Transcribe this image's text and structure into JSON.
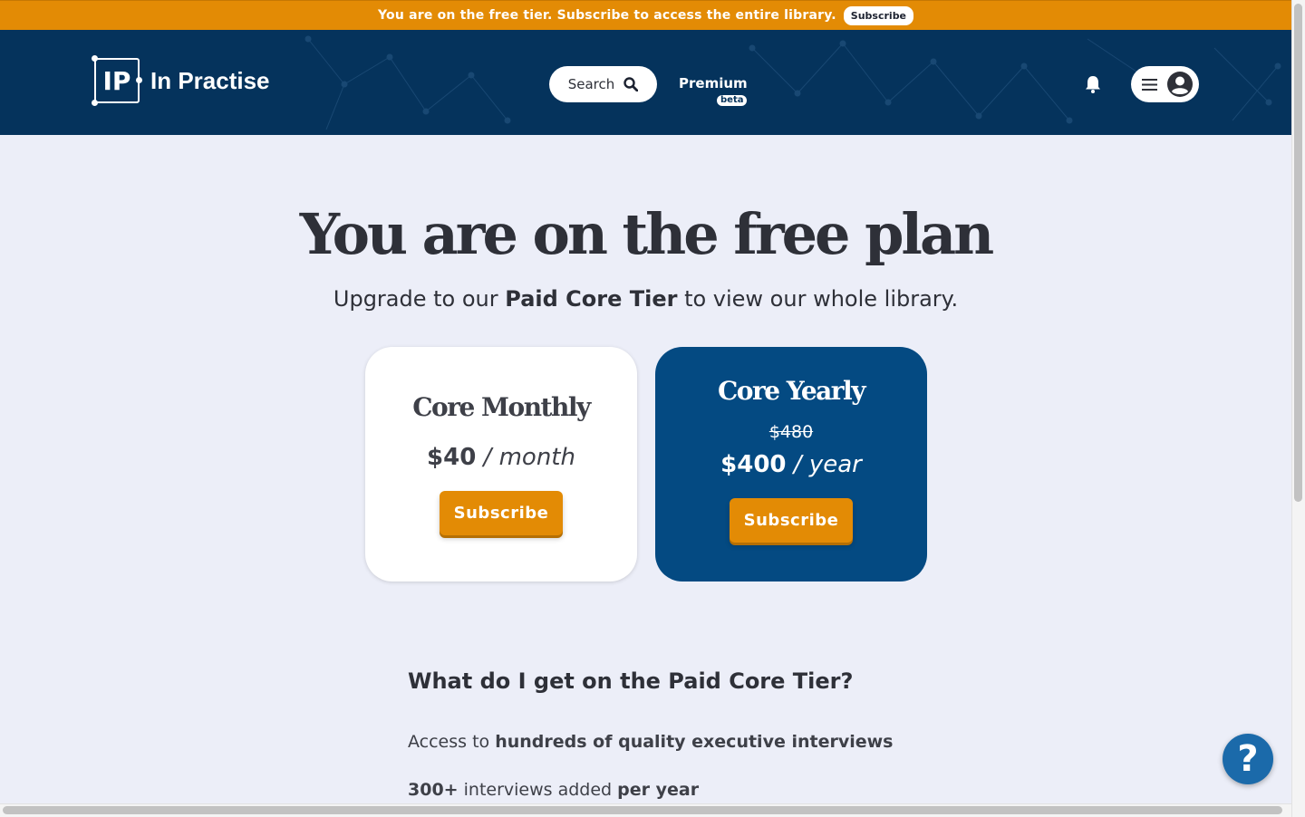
{
  "banner": {
    "message": "You are on the free tier. Subscribe to access the entire library.",
    "button_label": "Subscribe"
  },
  "header": {
    "logo_mark": "IP",
    "logo_text": "In Practise",
    "search_label": "Search",
    "premium_label": "Premium",
    "beta_label": "beta",
    "icons": [
      "search-icon",
      "bell-icon",
      "menu-icon",
      "account-icon"
    ]
  },
  "hero": {
    "title": "You are on the free plan",
    "subtitle_before": "Upgrade to our ",
    "subtitle_bold": "Paid Core Tier",
    "subtitle_after": " to view our whole library."
  },
  "plans": [
    {
      "title": "Core Monthly",
      "price": "$40",
      "period": " / month",
      "button_label": "Subscribe"
    },
    {
      "title": "Core Yearly",
      "old_price": "$480",
      "price": "$400",
      "period": " / year",
      "button_label": "Subscribe"
    }
  ],
  "features": {
    "title": "What do I get on the Paid Core Tier?",
    "items": [
      {
        "before": "Access to ",
        "bold": "hundreds of quality executive interviews",
        "after": ""
      },
      {
        "before": "",
        "bold": "300+",
        "after": " interviews added ",
        "bold2": "per year"
      }
    ]
  },
  "help": {
    "label": "?"
  },
  "colors": {
    "banner": "#e38b05",
    "header": "#05335c",
    "yearly_card": "#044a82",
    "accent": "#e38b05",
    "background": "#eceef8"
  }
}
